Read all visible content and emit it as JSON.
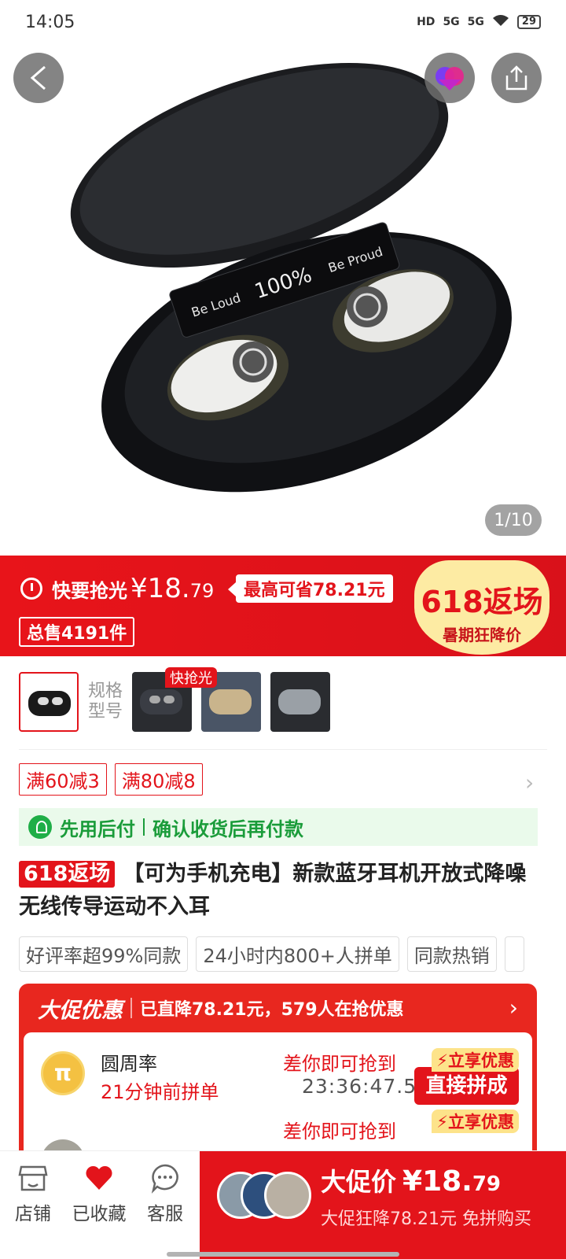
{
  "status_bar": {
    "time": "14:05",
    "network1": "5G",
    "network2": "5G",
    "battery": "29"
  },
  "hero": {
    "page_indicator": "1/10",
    "earbud_screen_left": "Be Loud",
    "earbud_screen_center": "100%",
    "earbud_screen_right": "Be Proud"
  },
  "price_banner": {
    "flash_label": "快要抢光",
    "price_int": "¥18.",
    "price_dec": "79",
    "save_label": "最高可省78.21元",
    "total_sold": "总售4191件",
    "badge_line1": "618返场",
    "badge_line2": "暑期狂降价"
  },
  "variants": {
    "label_line1": "规格",
    "label_line2": "型号",
    "snap_tag": "快抢光"
  },
  "coupons": [
    "满60减3",
    "满80减8"
  ],
  "pay_later": {
    "left": "先用后付",
    "right": "确认收货后再付款"
  },
  "title": {
    "tag": "618返场",
    "text": "【可为手机充电】新款蓝牙耳机开放式降噪无线传导运动不入耳"
  },
  "feature_tags": [
    "好评率超99%同款",
    "24小时内800+人拼单",
    "同款热销"
  ],
  "promo": {
    "logo": "大促优惠",
    "desc": "已直降78.21元，579人在抢优惠",
    "groups": [
      {
        "name": "圆周率",
        "time": "21分钟前拼单",
        "need": "差你即可抢到",
        "countdown": "23:36:47.5",
        "btn_top": "立享优惠",
        "btn_main": "直接拼成"
      },
      {
        "name": "",
        "time": "",
        "need": "差你即可抢到",
        "countdown": "",
        "btn_top": "立享优惠",
        "btn_main": ""
      }
    ]
  },
  "bottom_bar": {
    "store": "店铺",
    "favorited": "已收藏",
    "service": "客服",
    "buy_label": "大促价",
    "buy_price_int": "¥18.",
    "buy_price_dec": "79",
    "buy_sub": "大促狂降78.21元 免拼购买"
  },
  "colors": {
    "brand_red": "#e3141b",
    "pay_green": "#1a9c3a",
    "badge_yellow": "#fdeba3"
  }
}
